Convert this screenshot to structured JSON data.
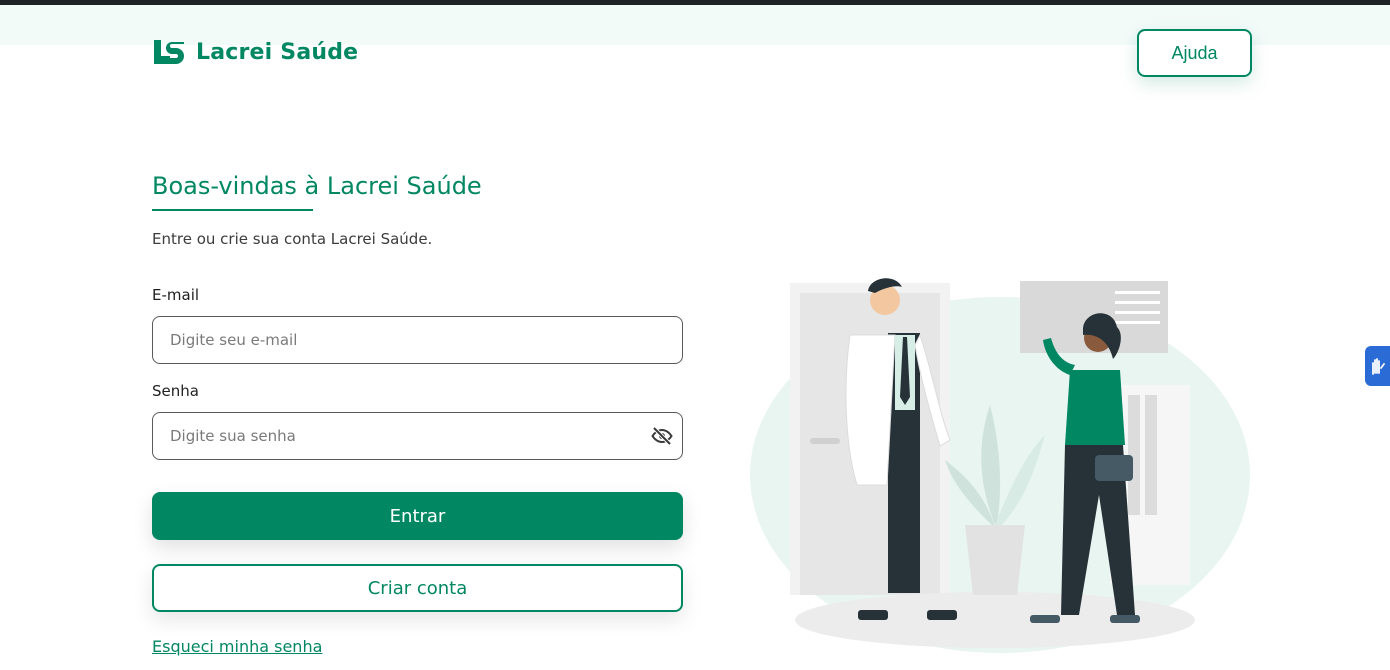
{
  "brand": {
    "logo_text": "Lacrei Saúde",
    "primary_color": "#018762",
    "accent_color": "#2a6bd6"
  },
  "header": {
    "help_label": "Ajuda"
  },
  "login": {
    "title": "Boas-vindas à Lacrei Saúde",
    "subtitle": "Entre ou crie sua conta Lacrei Saúde.",
    "email_label": "E-mail",
    "email_placeholder": "Digite seu e-mail",
    "email_value": "",
    "password_label": "Senha",
    "password_placeholder": "Digite sua senha",
    "password_value": "",
    "password_toggle_icon": "eye-off-icon",
    "submit_label": "Entrar",
    "create_account_label": "Criar conta",
    "forgot_password_label": "Esqueci minha senha"
  },
  "accessibility": {
    "widget_icon": "sign-language-hands-icon"
  }
}
